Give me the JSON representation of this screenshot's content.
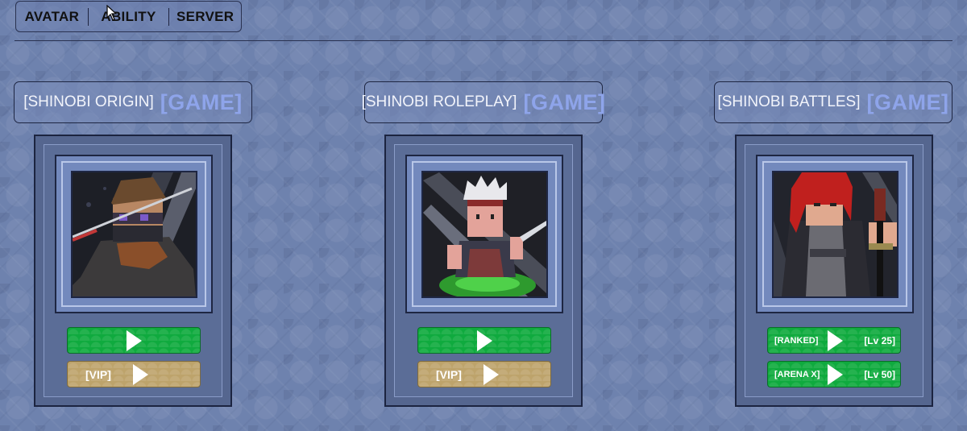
{
  "nav": {
    "items": [
      "AVATAR",
      "ABILITY",
      "SERVER"
    ]
  },
  "games": [
    {
      "name": "[SHINOBI ORIGIN]",
      "tag": "[GAME]",
      "buttons": {
        "play": "",
        "vip": "[VIP]"
      }
    },
    {
      "name": "[SHINOBI ROLEPLAY]",
      "tag": "[GAME]",
      "buttons": {
        "play": "",
        "vip": "[VIP]"
      }
    },
    {
      "name": "[SHINOBI BATTLES]",
      "tag": "[GAME]",
      "buttons": {
        "ranked": "[RANKED]",
        "ranked_level": "[Lv 25]",
        "arena": "[ARENA X]",
        "arena_level": "[Lv 50]"
      }
    }
  ],
  "colors": {
    "background": "#6e82ae",
    "play_green": "#0faa3e",
    "vip_gold": "#bda36b",
    "title_tag": "#8ea4ea"
  },
  "icons": {
    "play": "play-triangle-icon",
    "cursor": "mouse-pointer-icon"
  }
}
